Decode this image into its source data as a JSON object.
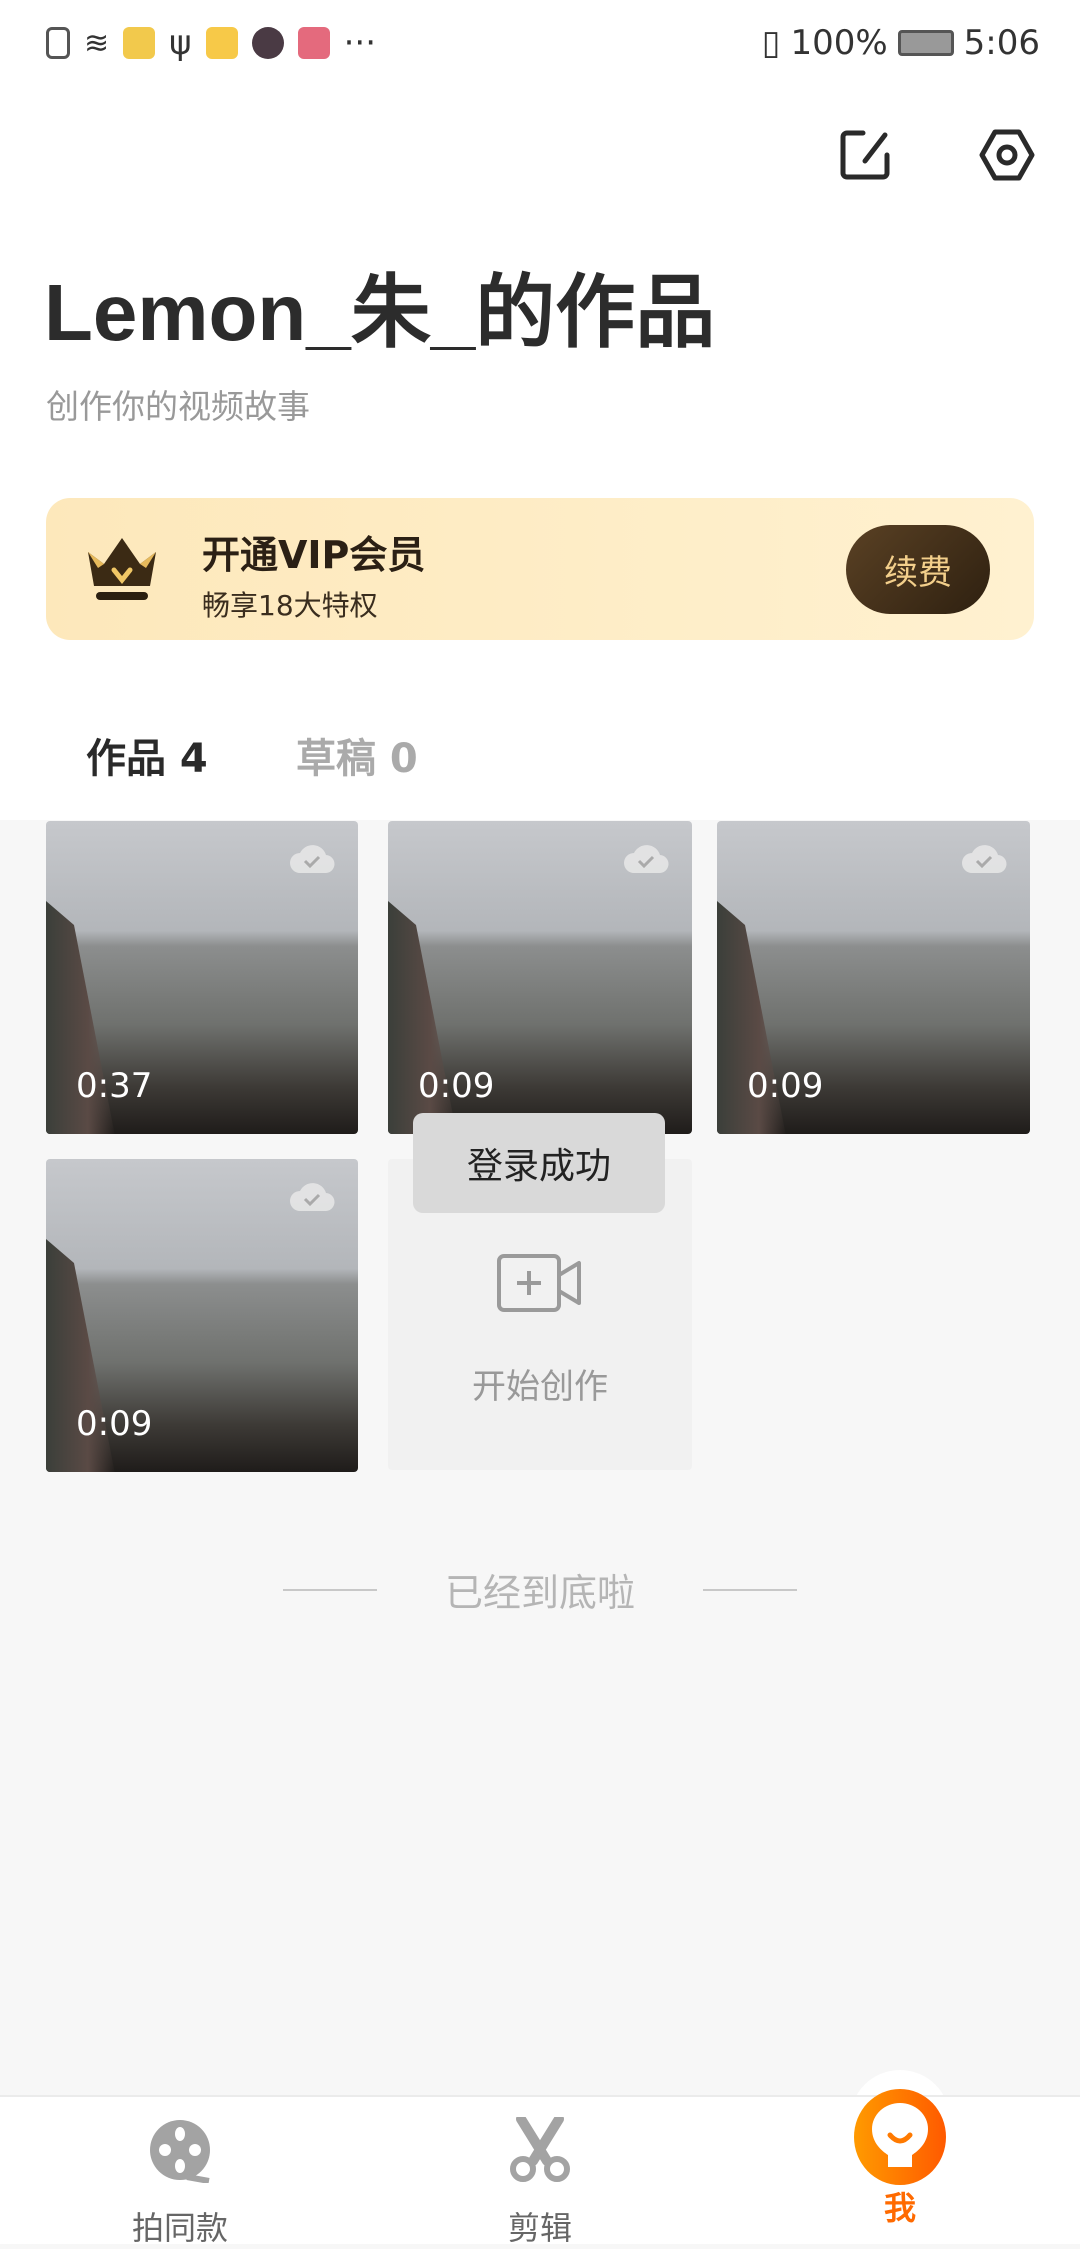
{
  "status_bar": {
    "battery": "100%",
    "time": "5:06"
  },
  "header": {
    "title": "Lemon_朱_的作品",
    "subtitle": "创作你的视频故事"
  },
  "vip": {
    "title": "开通VIP会员",
    "subtitle": "畅享18大特权",
    "button": "续费"
  },
  "tabs": [
    {
      "label": "作品 4",
      "active": true
    },
    {
      "label": "草稿 0",
      "active": false
    }
  ],
  "works": [
    {
      "duration": "0:37"
    },
    {
      "duration": "0:09"
    },
    {
      "duration": "0:09"
    },
    {
      "duration": "0:09"
    }
  ],
  "create": {
    "label": "开始创作"
  },
  "toast": "登录成功",
  "end_text": "已经到底啦",
  "nav": [
    {
      "label": "拍同款"
    },
    {
      "label": "剪辑"
    },
    {
      "label": "我",
      "active": true
    }
  ],
  "colors": {
    "accent": "#ff6a00",
    "vip_bg": "#fde8bb",
    "vip_btn": "#3f2c16"
  }
}
